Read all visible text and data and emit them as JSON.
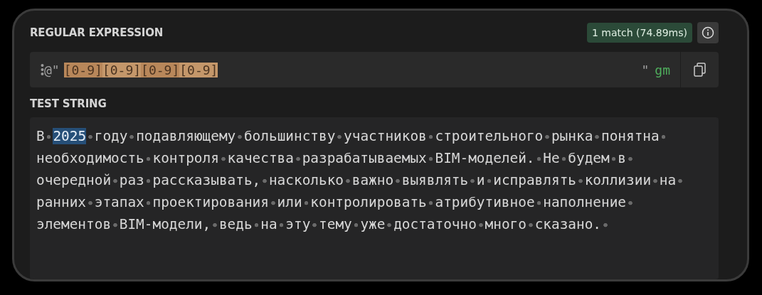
{
  "regex_section": {
    "label": "REGULAR EXPRESSION",
    "match_badge": "1 match (74.89ms)",
    "prefix": "@\"",
    "pattern_tokens": [
      "[0-9]",
      "[0-9]",
      "[0-9]",
      "[0-9]"
    ],
    "suffix": "\"",
    "flags": "gm"
  },
  "test_section": {
    "label": "TEST STRING",
    "lines": [
      [
        {
          "text": "В ",
          "match": false
        },
        {
          "text": "2025",
          "match": true
        },
        {
          "text": " году подавляющему большинству участников строительного рынка понятна ",
          "match": false
        }
      ],
      [
        {
          "text": "необходимость контроля качества разрабатываемых BIM-моделей. Не будем в ",
          "match": false
        }
      ],
      [
        {
          "text": "очередной раз рассказывать, насколько важно выявлять и исправлять коллизии на ",
          "match": false
        }
      ],
      [
        {
          "text": "ранних этапах проектирования или контролировать атрибутивное наполнение ",
          "match": false
        }
      ],
      [
        {
          "text": "элементов BIM-модели, ведь на эту тему уже достаточно много сказано. ",
          "match": false
        }
      ]
    ]
  }
}
